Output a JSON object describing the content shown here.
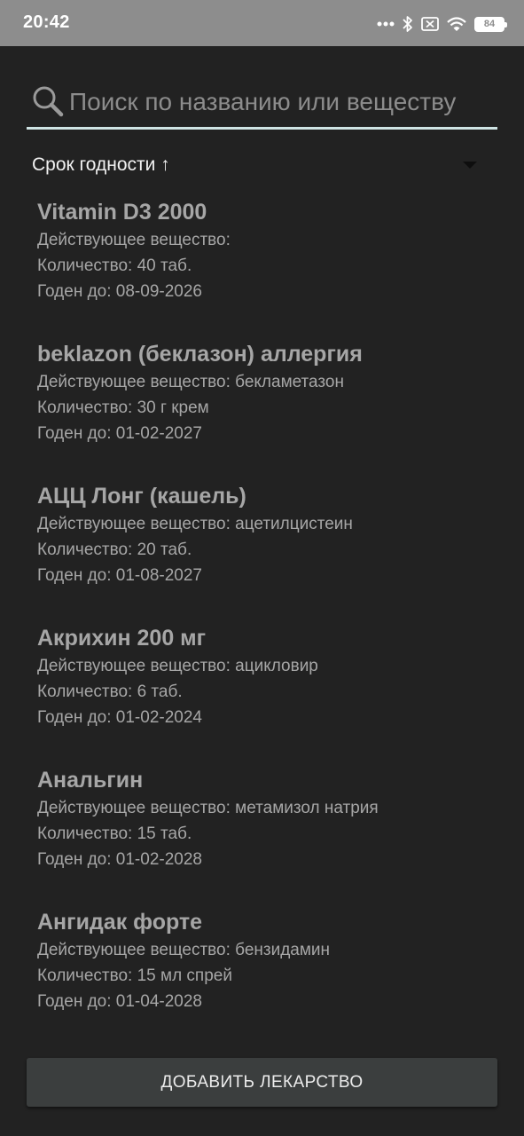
{
  "status_bar": {
    "time": "20:42",
    "battery": "84",
    "icons": [
      "more-dots-icon",
      "bluetooth-icon",
      "sim-off-icon",
      "wifi-icon",
      "battery-icon"
    ]
  },
  "search": {
    "placeholder": "Поиск по названию или веществу",
    "value": "",
    "icon": "search-icon"
  },
  "sort": {
    "label": "Срок годности ↑",
    "icon": "dropdown-arrow-icon"
  },
  "medicines": [
    {
      "name": "Vitamin D3 2000",
      "substance": "Действующее вещество: ",
      "quantity": "Количество: 40 таб.",
      "expiry": "Годен до: 08-09-2026"
    },
    {
      "name": "beklazon (беклазон) аллергия",
      "substance": "Действующее вещество: бекламетазон",
      "quantity": "Количество: 30 г крем",
      "expiry": "Годен до: 01-02-2027"
    },
    {
      "name": "АЦЦ Лонг (кашель)",
      "substance": "Действующее вещество: ацетилцистеин",
      "quantity": "Количество: 20 таб.",
      "expiry": "Годен до: 01-08-2027"
    },
    {
      "name": "Акрихин 200 мг",
      "substance": "Действующее вещество: ацикловир",
      "quantity": "Количество: 6 таб.",
      "expiry": "Годен до: 01-02-2024"
    },
    {
      "name": "Анальгин",
      "substance": "Действующее вещество: метамизол натрия",
      "quantity": "Количество: 15 таб.",
      "expiry": "Годен до: 01-02-2028"
    },
    {
      "name": "Ангидак форте",
      "substance": "Действующее вещество: бензидамин",
      "quantity": "Количество: 15 мл спрей",
      "expiry": "Годен до: 01-04-2028"
    }
  ],
  "add_button": {
    "label": "ДОБАВИТЬ ЛЕКАРСТВО"
  },
  "colors": {
    "background": "#222222",
    "status_bar": "#8d8d8d",
    "search_underline": "#cfe4e4",
    "item_text": "#a6a6a6",
    "button_bg": "#3b3e3e"
  }
}
